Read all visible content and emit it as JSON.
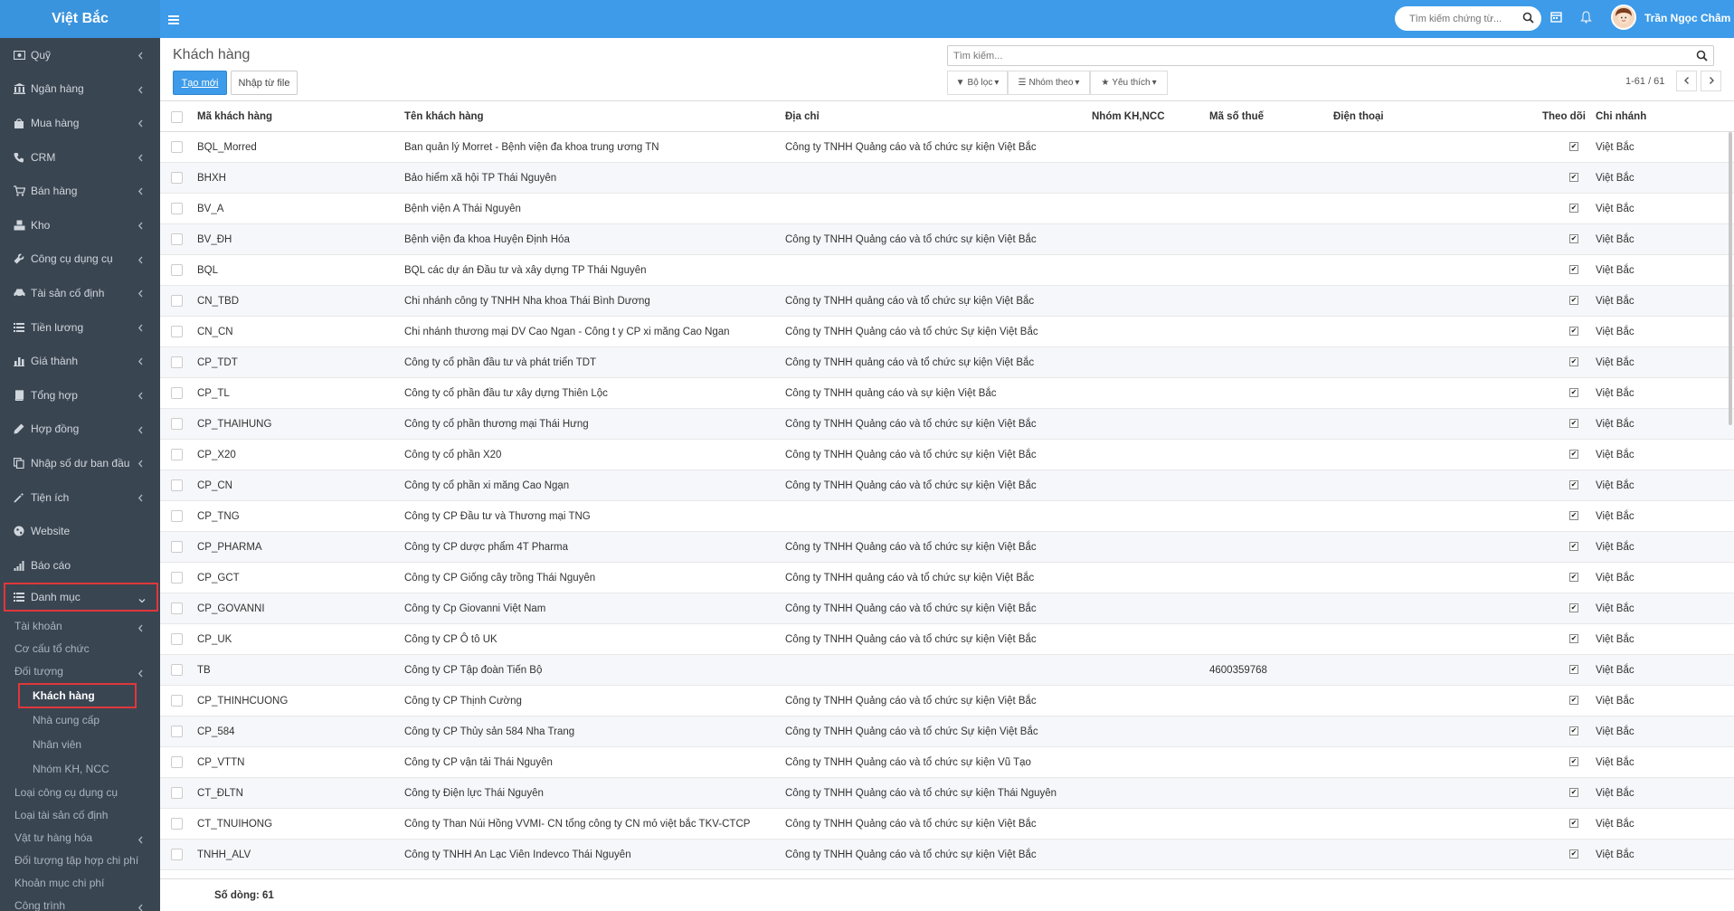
{
  "brand": "Việt Bắc",
  "top_search": {
    "placeholder": "Tìm kiếm chứng từ..."
  },
  "user": {
    "name": "Trần Ngọc Châm"
  },
  "sidebar": {
    "items": [
      {
        "label": "Quỹ",
        "icon": "money-icon"
      },
      {
        "label": "Ngân hàng",
        "icon": "bank-icon"
      },
      {
        "label": "Mua hàng",
        "icon": "shopping-bag-icon"
      },
      {
        "label": "CRM",
        "icon": "phone-icon"
      },
      {
        "label": "Bán hàng",
        "icon": "cart-icon"
      },
      {
        "label": "Kho",
        "icon": "cubes-icon"
      },
      {
        "label": "Công cụ dụng cụ",
        "icon": "wrench-icon"
      },
      {
        "label": "Tài sản cố định",
        "icon": "car-icon"
      },
      {
        "label": "Tiền lương",
        "icon": "list-icon"
      },
      {
        "label": "Giá thành",
        "icon": "bar-chart-icon"
      },
      {
        "label": "Tổng hợp",
        "icon": "book-icon"
      },
      {
        "label": "Hợp đồng",
        "icon": "pencil-icon"
      },
      {
        "label": "Nhập số dư ban đầu",
        "icon": "copy-icon"
      },
      {
        "label": "Tiện ích",
        "icon": "magic-icon"
      },
      {
        "label": "Website",
        "icon": "globe-icon"
      },
      {
        "label": "Báo cáo",
        "icon": "signal-icon"
      }
    ],
    "active": {
      "label": "Danh mục",
      "icon": "list-icon"
    },
    "sub": [
      {
        "label": "Tài khoản"
      },
      {
        "label": "Cơ cấu tổ chức"
      },
      {
        "label": "Đối tượng"
      }
    ],
    "sub2": [
      {
        "label": "Khách hàng"
      },
      {
        "label": "Nhà cung cấp"
      },
      {
        "label": "Nhân viên"
      },
      {
        "label": "Nhóm KH, NCC"
      }
    ],
    "sub_after": [
      {
        "label": "Loại công cụ dụng cụ"
      },
      {
        "label": "Loại tài sản cố định"
      },
      {
        "label": "Vật tư hàng hóa"
      },
      {
        "label": "Đối tượng tập hợp chi phí"
      },
      {
        "label": "Khoản mục chi phí"
      },
      {
        "label": "Công trình"
      }
    ]
  },
  "page": {
    "title": "Khách hàng",
    "create_label": "Tạo mới",
    "import_label": "Nhập từ file",
    "search_placeholder": "Tìm kiếm...",
    "filter_label": "Bộ lọc",
    "group_label": "Nhóm theo",
    "fav_label": "Yêu thích",
    "pager": "1-61 / 61"
  },
  "table": {
    "headers": [
      "Mã khách hàng",
      "Tên khách hàng",
      "Địa chỉ",
      "Nhóm KH,NCC",
      "Mã số thuế",
      "Điện thoại",
      "Theo dõi",
      "Chi nhánh"
    ],
    "rows": [
      [
        "BQL_Morred",
        "Ban quản lý Morret - Bệnh viện đa khoa trung ương TN",
        "Công ty TNHH Quảng cáo và tổ chức sự kiện Việt Bắc",
        "",
        "",
        "",
        "✔",
        "Việt Bắc"
      ],
      [
        "BHXH",
        "Bảo hiểm xã hội TP Thái Nguyên",
        "",
        "",
        "",
        "",
        "✔",
        "Việt Bắc"
      ],
      [
        "BV_A",
        "Bệnh viện A Thái Nguyên",
        "",
        "",
        "",
        "",
        "✔",
        "Việt Bắc"
      ],
      [
        "BV_ĐH",
        "Bệnh viện đa khoa Huyện Định Hóa",
        "Công ty TNHH Quảng cáo và tổ chức sự kiện Việt Bắc",
        "",
        "",
        "",
        "✔",
        "Việt Bắc"
      ],
      [
        "BQL",
        "BQL các dự án Đầu tư và xây dựng TP Thái Nguyên",
        "",
        "",
        "",
        "",
        "✔",
        "Việt Bắc"
      ],
      [
        "CN_TBD",
        "Chi nhánh công ty TNHH Nha khoa Thái Bình Dương",
        "Công ty TNHH quảng cáo và tổ chức sự kiện Việt Bắc",
        "",
        "",
        "",
        "✔",
        "Việt Bắc"
      ],
      [
        "CN_CN",
        "Chi nhánh thương mại DV Cao Ngan - Công t y CP xi măng Cao Ngan",
        "Công ty TNHH Quảng cáo và tổ chức Sự kiện Việt Bắc",
        "",
        "",
        "",
        "✔",
        "Việt Bắc"
      ],
      [
        "CP_TDT",
        "Công ty cổ phần đầu tư và phát triển TDT",
        "Công ty TNHH quảng cáo và tổ chức sự kiện Việt Bắc",
        "",
        "",
        "",
        "✔",
        "Việt Bắc"
      ],
      [
        "CP_TL",
        "Công ty cổ phần đầu tư xây dựng Thiên Lộc",
        "Công ty TNHH quảng cáo và sự kiện Việt Bắc",
        "",
        "",
        "",
        "✔",
        "Việt Bắc"
      ],
      [
        "CP_THAIHUNG",
        "Công ty cổ phần thương mại Thái Hưng",
        "Công ty TNHH Quảng cáo và tổ chức sự kiện Việt Bắc",
        "",
        "",
        "",
        "✔",
        "Việt Bắc"
      ],
      [
        "CP_X20",
        "Công ty cổ phần X20",
        "Công ty TNHH Quảng cáo và tổ chức sự kiện Việt Bắc",
        "",
        "",
        "",
        "✔",
        "Việt Bắc"
      ],
      [
        "CP_CN",
        "Công ty cổ phần xi măng Cao Ngạn",
        "Công ty TNHH Quảng cáo và tổ chức sự kiện Việt Bắc",
        "",
        "",
        "",
        "✔",
        "Việt Bắc"
      ],
      [
        "CP_TNG",
        "Công ty CP Đầu tư và Thương mại TNG",
        "",
        "",
        "",
        "",
        "✔",
        "Việt Bắc"
      ],
      [
        "CP_PHARMA",
        "Công ty CP dược phẩm 4T Pharma",
        "Công ty TNHH Quảng cáo và tổ chức sự kiện Việt Bắc",
        "",
        "",
        "",
        "✔",
        "Việt Bắc"
      ],
      [
        "CP_GCT",
        "Công ty CP Giống cây trồng Thái Nguyên",
        "Công ty TNHH quảng cáo và tổ chức sự kiện Việt Bắc",
        "",
        "",
        "",
        "✔",
        "Việt Bắc"
      ],
      [
        "CP_GOVANNI",
        "Công ty Cp Giovanni Việt Nam",
        "Công ty TNHH Quảng cáo và tổ chức sự kiện Việt Bắc",
        "",
        "",
        "",
        "✔",
        "Việt Bắc"
      ],
      [
        "CP_UK",
        "Công ty CP Ô tô UK",
        "Công ty TNHH Quảng cáo và tổ chức sự kiện Việt Bắc",
        "",
        "",
        "",
        "✔",
        "Việt Bắc"
      ],
      [
        "TB",
        "Công ty CP Tập đoàn Tiến Bộ",
        "",
        "",
        "4600359768",
        "",
        "✔",
        "Việt Bắc"
      ],
      [
        "CP_THINHCUONG",
        "Công ty CP Thịnh Cường",
        "Công ty TNHH Quảng cáo và tổ chức sự kiện Việt Bắc",
        "",
        "",
        "",
        "✔",
        "Việt Bắc"
      ],
      [
        "CP_584",
        "Công ty CP Thủy sản 584 Nha Trang",
        "Công ty TNHH Quảng cáo và tổ chức Sự kiện Việt Bắc",
        "",
        "",
        "",
        "✔",
        "Việt Bắc"
      ],
      [
        "CP_VTTN",
        "Công ty CP vận tải Thái Nguyên",
        "Công ty TNHH Quảng cáo và tổ chức sự kiện Vũ Tạo",
        "",
        "",
        "",
        "✔",
        "Việt Bắc"
      ],
      [
        "CT_ĐLTN",
        "Công ty Điện lực Thái Nguyên",
        "Công ty TNHH Quảng cáo và tổ chức sự kiện Thái Nguyên",
        "",
        "",
        "",
        "✔",
        "Việt Bắc"
      ],
      [
        "CT_TNUIHONG",
        "Công ty Than Núi Hồng VVMI- CN tổng công ty CN mỏ việt bắc TKV-CTCP",
        "Công ty TNHH Quảng cáo và tổ chức sự kiện Việt Bắc",
        "",
        "",
        "",
        "✔",
        "Việt Bắc"
      ],
      [
        "TNHH_ALV",
        "Công ty TNHH An Lạc Viên Indevco Thái Nguyên",
        "Công ty TNHH Quảng cáo và tổ chức sự kiện Việt Bắc",
        "",
        "",
        "",
        "✔",
        "Việt Bắc"
      ]
    ],
    "footer": "Số dòng: 61"
  },
  "colors": {
    "topbar": "#3d9be9",
    "sidebar": "#3a4552",
    "highlight": "#e0373a"
  }
}
